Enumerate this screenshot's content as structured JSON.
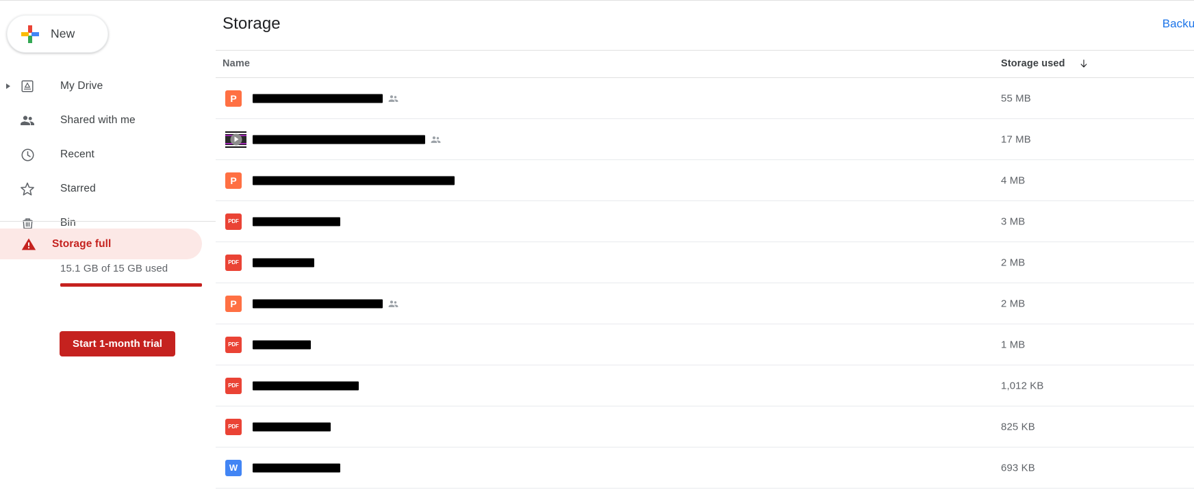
{
  "app": {
    "page_title": "Storage"
  },
  "colors": {
    "accent_blue": "#1a73e8",
    "danger_red": "#c5221f",
    "danger_bg": "#fce8e6",
    "pdf_red": "#ea4335",
    "ppt_orange": "#ff7043",
    "word_blue": "#4285f4",
    "text_primary": "#202124",
    "text_secondary": "#5f6368"
  },
  "sidebar": {
    "new_button": {
      "label": "New",
      "icon": "plus-icon"
    },
    "items": [
      {
        "label": "My Drive",
        "icon": "my-drive-icon",
        "expandable": true
      },
      {
        "label": "Shared with me",
        "icon": "shared-with-me-icon",
        "expandable": false
      },
      {
        "label": "Recent",
        "icon": "clock-icon",
        "expandable": false
      },
      {
        "label": "Starred",
        "icon": "star-icon",
        "expandable": false
      },
      {
        "label": "Bin",
        "icon": "trash-icon",
        "expandable": false
      }
    ],
    "storage": {
      "status_label": "Storage full",
      "status_icon": "warning-triangle-icon",
      "quota_text": "15.1 GB of 15 GB used",
      "quota_percent": 100,
      "trial_button_label": "Start 1-month trial"
    }
  },
  "header": {
    "title": "Storage",
    "backup_link": "Backup"
  },
  "table": {
    "columns": [
      {
        "key": "name",
        "label": "Name",
        "sorted": false
      },
      {
        "key": "storage",
        "label": "Storage used",
        "sorted": true,
        "sort_direction": "descending",
        "sort_icon": "arrow-down-icon"
      }
    ],
    "rows": [
      {
        "name": "[redacted]",
        "name_redacted": true,
        "redaction_width": 190,
        "icon": "powerpoint-icon",
        "shared": true,
        "storage_used": "55 MB"
      },
      {
        "name": "[redacted]",
        "name_redacted": true,
        "redaction_width": 252,
        "icon": "video-icon",
        "shared": true,
        "storage_used": "17 MB"
      },
      {
        "name": "[redacted]",
        "name_redacted": true,
        "redaction_width": 295,
        "icon": "powerpoint-icon",
        "shared": false,
        "storage_used": "4 MB"
      },
      {
        "name": "[redacted]",
        "name_redacted": true,
        "redaction_width": 128,
        "icon": "pdf-icon",
        "shared": false,
        "storage_used": "3 MB"
      },
      {
        "name": "[redacted]",
        "name_redacted": true,
        "redaction_width": 90,
        "icon": "pdf-icon",
        "shared": false,
        "storage_used": "2 MB"
      },
      {
        "name": "[redacted]",
        "name_redacted": true,
        "redaction_width": 190,
        "icon": "powerpoint-icon",
        "shared": true,
        "storage_used": "2 MB"
      },
      {
        "name": "[redacted]",
        "name_redacted": true,
        "redaction_width": 85,
        "icon": "pdf-icon",
        "shared": false,
        "storage_used": "1 MB"
      },
      {
        "name": "[redacted]",
        "name_redacted": true,
        "redaction_width": 155,
        "icon": "pdf-icon",
        "shared": false,
        "storage_used": "1,012 KB"
      },
      {
        "name": "[redacted]",
        "name_redacted": true,
        "redaction_width": 114,
        "icon": "pdf-icon",
        "shared": false,
        "storage_used": "825 KB"
      },
      {
        "name": "[redacted]",
        "name_redacted": true,
        "redaction_width": 128,
        "icon": "word-icon",
        "shared": false,
        "storage_used": "693 KB"
      }
    ],
    "icon_labels": {
      "powerpoint-icon": "P",
      "pdf-icon": "PDF",
      "word-icon": "W"
    }
  }
}
